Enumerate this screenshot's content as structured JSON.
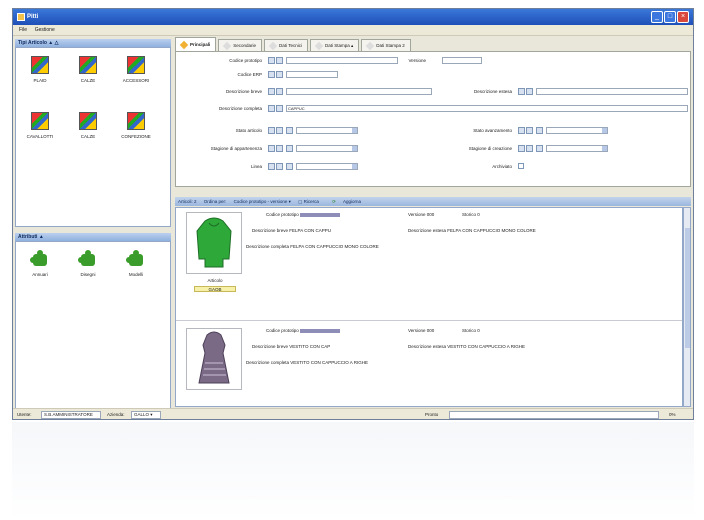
{
  "window": {
    "title": "Pitti"
  },
  "menu": [
    "File",
    "Gestione"
  ],
  "left": {
    "types_header": "Tipi Articolo ▲ △",
    "types": [
      {
        "label": "PLAID"
      },
      {
        "label": "CALZE"
      },
      {
        "label": "ACCESSORI"
      },
      {
        "label": "CAVALLOTTI"
      },
      {
        "label": "CALZE"
      },
      {
        "label": "CONFEZIONE"
      }
    ],
    "attrs_header": "Attributi ▲",
    "attrs": [
      {
        "label": "Annuari"
      },
      {
        "label": "Disegni"
      },
      {
        "label": "Modelli"
      }
    ]
  },
  "tabs": [
    "Principali",
    "Secondarie",
    "Dati Tecnici",
    "Dati Stampa ▴",
    "Dati Stampa 2"
  ],
  "form": {
    "codice_prototipo": "Codice prototipo",
    "versione": "Versione",
    "codice_erp": "Codice ERP",
    "descrizione_breve": "Descrizione breve",
    "descrizione_estesa": "Descrizione estesa",
    "descrizione_completa": "Descrizione completa",
    "descrizione_completa_value": "CAPPUC",
    "stato_articolo": "Stato articolo",
    "stato_avanzamento": "Stato avanzamento",
    "stagione_appartenenza": "Stagione di appartenenza",
    "stagione_creazione": "Stagione di creazione",
    "linea": "Linea",
    "archiviato": "Archiviato"
  },
  "listbar": {
    "articoli": "Articoli: 2",
    "ordina": "Ordina per:",
    "ordina_value": "Codice prototipo - versione ▾",
    "ricerca": "Ricerca",
    "aggiorna": "Aggiorna"
  },
  "items": [
    {
      "codice_label": "Codice prototipo",
      "versione_label": "Versione",
      "versione_value": "000",
      "storico_label": "Storico",
      "storico_value": "0",
      "breve_label": "Descrizione breve",
      "breve_value": "FELPA CON CAPPU",
      "estesa_label": "Descrizione estesa",
      "estesa_value": "FELPA CON CAPPUCCIO MONO COLORE",
      "completa_label": "Descrizione completa",
      "completa_value": "FELPA CON CAPPUCCIO MONO COLORE",
      "caption": "Articolo",
      "tag": "GAOB",
      "color": "#2fa83a"
    },
    {
      "codice_label": "Codice prototipo",
      "versione_label": "Versione",
      "versione_value": "000",
      "storico_label": "Storico",
      "storico_value": "0",
      "breve_label": "Descrizione breve",
      "breve_value": "VESTITO CON CAP",
      "estesa_label": "Descrizione estesa",
      "estesa_value": "VESTITO CON CAPPUCCIO A RIGHE",
      "completa_label": "Descrizione completa",
      "completa_value": "VESTITO CON CAPPUCCIO A RIGHE",
      "color": "#7a6a86"
    }
  ],
  "status": {
    "utente_label": "Utente:",
    "utente_value": "S.B.AMMINISTRATORE",
    "azienda_label": "Azienda:",
    "azienda_value": "GALLO ▾",
    "pronto": "Pronto",
    "zoom": "0%"
  }
}
